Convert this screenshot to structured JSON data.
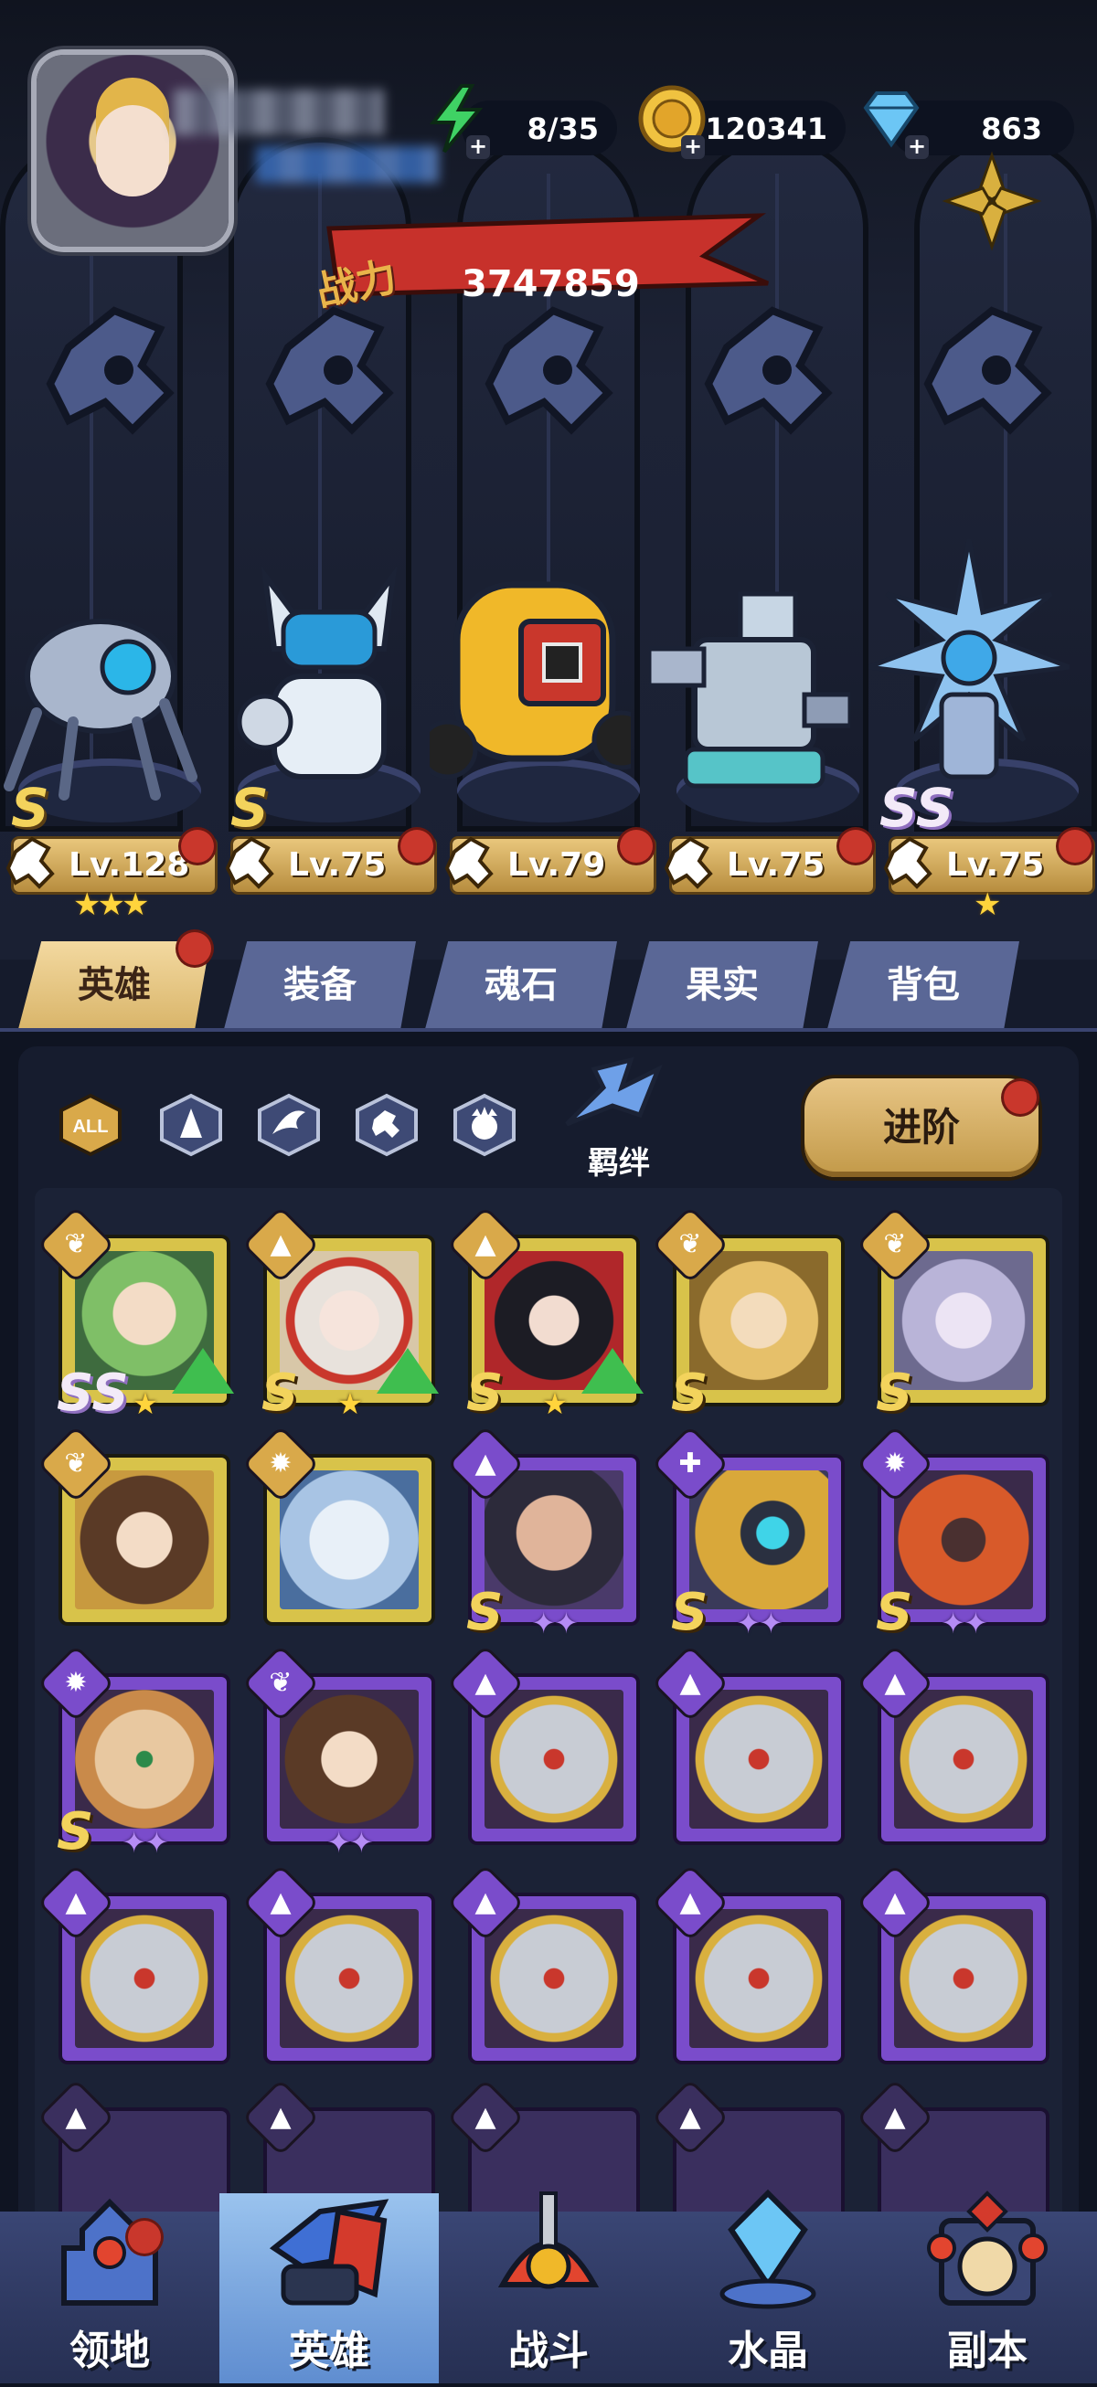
{
  "resources": {
    "energy": {
      "value": "8/35",
      "icon": "energy-bolt-icon"
    },
    "gold": {
      "value": "120341",
      "icon": "gold-coin-icon"
    },
    "gems": {
      "value": "863",
      "icon": "diamond-icon"
    }
  },
  "power": {
    "label": "战力",
    "value": "3747859"
  },
  "team": [
    {
      "level": "Lv.128",
      "grade": "S",
      "stars": "★★★"
    },
    {
      "level": "Lv.75",
      "grade": "S",
      "stars": ""
    },
    {
      "level": "Lv.79",
      "grade": "",
      "stars": ""
    },
    {
      "level": "Lv.75",
      "grade": "",
      "stars": ""
    },
    {
      "level": "Lv.75",
      "grade": "SS",
      "stars": "★"
    }
  ],
  "tabs": [
    "英雄",
    "装备",
    "魂石",
    "果实",
    "背包"
  ],
  "filters": {
    "all": "ALL",
    "bond": "羁绊",
    "advance": "进阶"
  },
  "cards": [
    {
      "grade": "SS",
      "stars": "★",
      "frame": "gold"
    },
    {
      "grade": "S",
      "stars": "★",
      "frame": "gold"
    },
    {
      "grade": "S",
      "stars": "★",
      "frame": "gold"
    },
    {
      "grade": "S",
      "stars": "",
      "frame": "gold"
    },
    {
      "grade": "S",
      "stars": "",
      "frame": "gold"
    },
    {
      "grade": "",
      "stars": "",
      "frame": "gold"
    },
    {
      "grade": "",
      "stars": "",
      "frame": "gold"
    },
    {
      "grade": "S",
      "stars": "✦✦",
      "frame": "purple"
    },
    {
      "grade": "S",
      "stars": "✦✦",
      "frame": "purple"
    },
    {
      "grade": "S",
      "stars": "✦✦",
      "frame": "purple"
    },
    {
      "grade": "S",
      "stars": "✦✦",
      "frame": "purple"
    },
    {
      "grade": "",
      "stars": "✦✦",
      "frame": "purple"
    },
    {
      "grade": "",
      "stars": "",
      "frame": "purple"
    },
    {
      "grade": "",
      "stars": "",
      "frame": "purple"
    },
    {
      "grade": "",
      "stars": "",
      "frame": "purple"
    }
  ],
  "nav": [
    "领地",
    "英雄",
    "战斗",
    "水晶",
    "副本"
  ],
  "colors": {
    "accent": "#d9b56a",
    "tab": "#5a6796",
    "badge": "#c9372c"
  }
}
